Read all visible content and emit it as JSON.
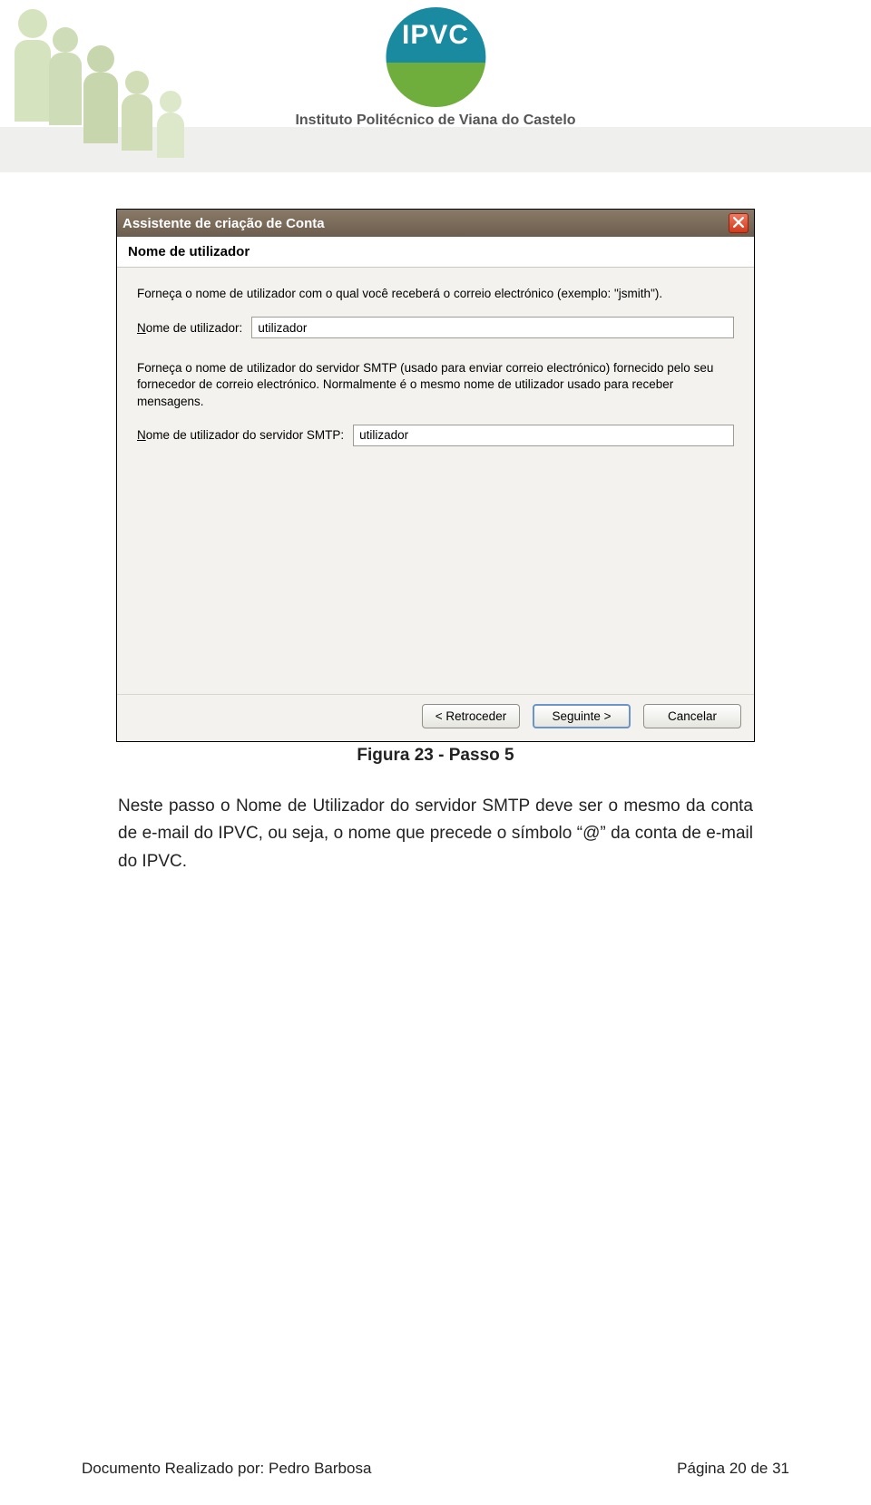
{
  "header": {
    "institute_name": "Instituto Politécnico de Viana do Castelo",
    "logo_letters": "IPVC"
  },
  "dialog": {
    "window_title": "Assistente de criação de Conta",
    "section_title": "Nome de utilizador",
    "instruction1": "Forneça o nome de utilizador com o qual você receberá o correio electrónico (exemplo: \"jsmith\").",
    "field1": {
      "label_prefix": "N",
      "label_rest": "ome de utilizador:",
      "value": "utilizador"
    },
    "instruction2": "Forneça o nome de utilizador do servidor SMTP (usado para enviar correio electrónico) fornecido pelo seu fornecedor de correio electrónico. Normalmente é o mesmo nome de utilizador usado para receber mensagens.",
    "field2": {
      "label_prefix": "N",
      "label_rest": "ome de utilizador do servidor SMTP:",
      "value": "utilizador"
    },
    "buttons": {
      "back": "< Retroceder",
      "next": "Seguinte >",
      "cancel": "Cancelar"
    }
  },
  "caption": "Figura 23 - Passo 5",
  "paragraph": "Neste passo o Nome de Utilizador do servidor SMTP deve ser o mesmo da conta de e-mail do IPVC, ou seja, o nome que precede o símbolo “@” da conta de e-mail do IPVC.",
  "footer": {
    "left": "Documento Realizado por: Pedro Barbosa",
    "right": "Página 20 de 31"
  }
}
